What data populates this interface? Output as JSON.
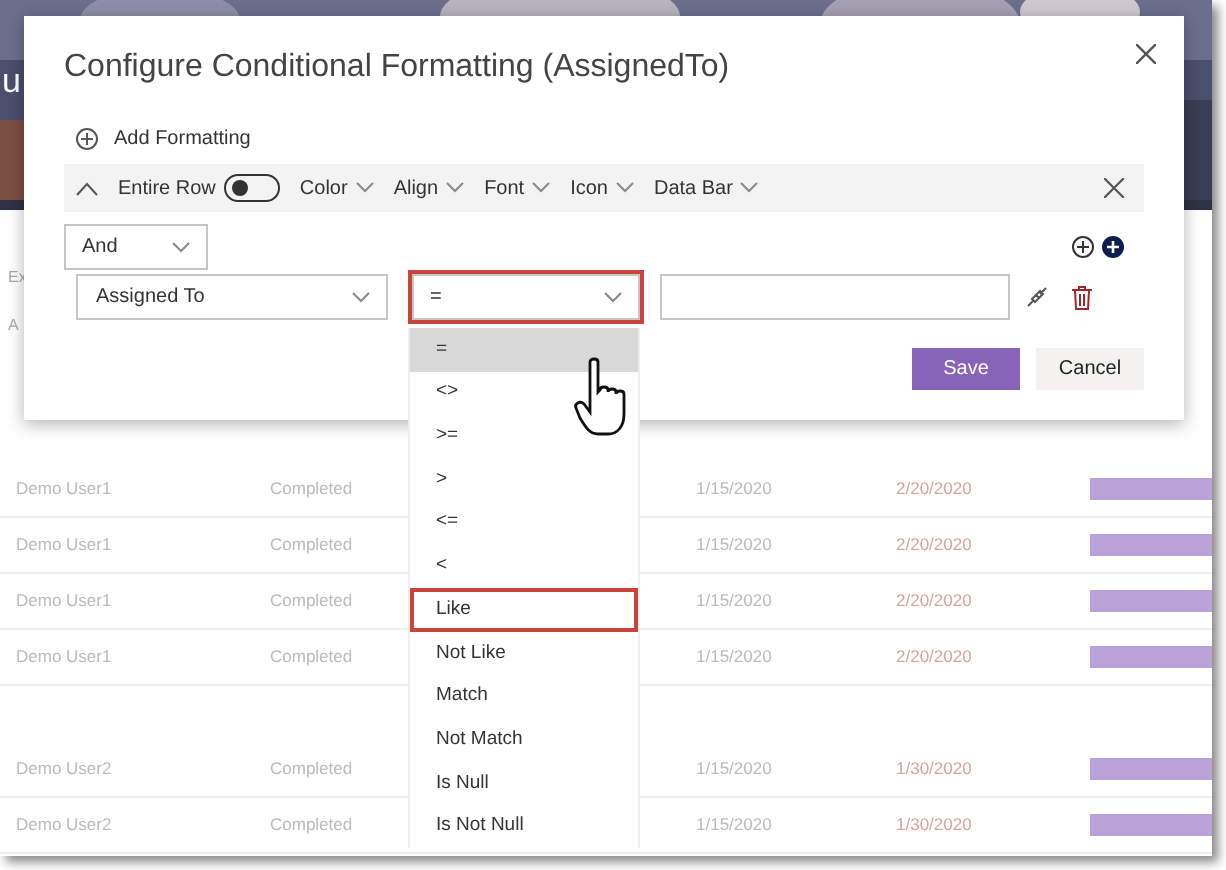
{
  "background": {
    "banner": {
      "kind": "picture",
      "text": "u"
    },
    "partial_labels": [
      "Ex",
      "A"
    ],
    "groups": [
      {
        "rows": [
          {
            "user": "Demo User1",
            "status": "Completed",
            "start": "1/15/2020",
            "due": "2/20/2020"
          },
          {
            "user": "Demo User1",
            "status": "Completed",
            "start": "1/15/2020",
            "due": "2/20/2020"
          },
          {
            "user": "Demo User1",
            "status": "Completed",
            "start": "1/15/2020",
            "due": "2/20/2020"
          },
          {
            "user": "Demo User1",
            "status": "Completed",
            "start": "1/15/2020",
            "due": "2/20/2020"
          }
        ]
      },
      {
        "rows": [
          {
            "user": "Demo User2",
            "status": "Completed",
            "start": "1/15/2020",
            "due": "1/30/2020"
          },
          {
            "user": "Demo User2",
            "status": "Completed",
            "start": "1/15/2020",
            "due": "1/30/2020"
          }
        ]
      }
    ]
  },
  "dialog": {
    "title": "Configure Conditional Formatting (AssignedTo)",
    "add_formatting": "Add Formatting",
    "format_bar": {
      "expanded": true,
      "entire_row_label": "Entire Row",
      "entire_row_on": false,
      "menus": [
        "Color",
        "Align",
        "Font",
        "Icon",
        "Data Bar"
      ]
    },
    "logic": "And",
    "condition": {
      "field": "Assigned To",
      "operator": {
        "value": "=",
        "outlined": true
      }
    },
    "operator_options": [
      {
        "label": "=",
        "selected": true,
        "outlined": false
      },
      {
        "label": "<>",
        "selected": false,
        "outlined": false
      },
      {
        "label": ">=",
        "selected": false,
        "outlined": false
      },
      {
        "label": ">",
        "selected": false,
        "outlined": false
      },
      {
        "label": "<=",
        "selected": false,
        "outlined": false
      },
      {
        "label": "<",
        "selected": false,
        "outlined": false
      },
      {
        "label": "Like",
        "selected": false,
        "outlined": true
      },
      {
        "label": "Not Like",
        "selected": false,
        "outlined": false
      },
      {
        "label": "Match",
        "selected": false,
        "outlined": false
      },
      {
        "label": "Not Match",
        "selected": false,
        "outlined": false
      },
      {
        "label": "Is Null",
        "selected": false,
        "outlined": false
      },
      {
        "label": "Is Not Null",
        "selected": false,
        "outlined": false
      }
    ],
    "buttons": [
      {
        "label": "Save",
        "kind": "primary"
      },
      {
        "label": "Cancel",
        "kind": "secondary"
      }
    ]
  }
}
